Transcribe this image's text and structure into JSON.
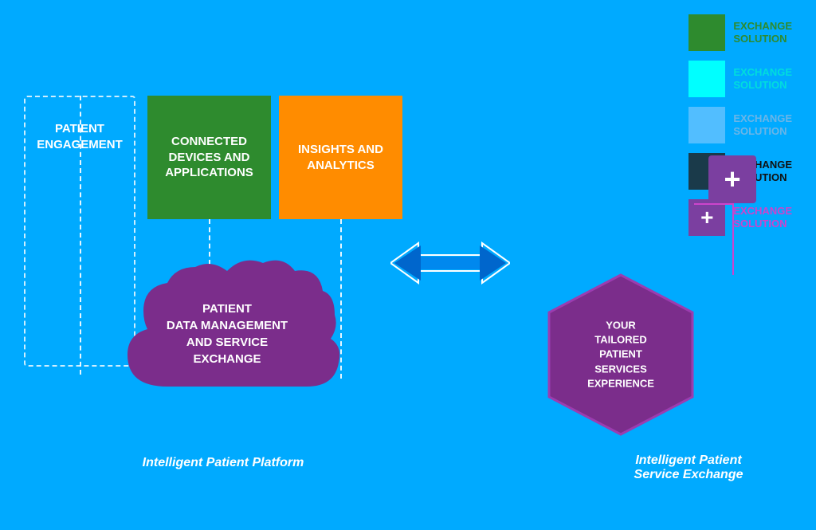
{
  "background_color": "#00AAFF",
  "legend": {
    "items": [
      {
        "id": "legend-green",
        "color": "#2E8B2E",
        "label": "EXCHANGE\nSOLUTION",
        "label_color": "#2E8B2E",
        "opacity": 1
      },
      {
        "id": "legend-cyan",
        "color": "#00FFFF",
        "label": "EXCHANGE\nSOLUTION",
        "label_color": "#00DDDD",
        "opacity": 1
      },
      {
        "id": "legend-light",
        "color": "#88CCFF",
        "label": "EXCHANGE\nSOLUTION",
        "label_color": "#88BBDD",
        "opacity": 0.6
      },
      {
        "id": "legend-dark",
        "color": "#1A3A4A",
        "label": "EXCHANGE\nSOLUTION",
        "label_color": "#222222",
        "opacity": 1
      },
      {
        "id": "legend-purple",
        "color": "#7B3FA0",
        "label": "EXCHANGE\nSOLUTION",
        "label_color": "#CC44CC",
        "opacity": 1
      }
    ]
  },
  "diagram": {
    "patient_engagement_label": "PATIENT\nENGAGEMENT",
    "connected_devices_label": "CONNECTED\nDEVICES AND\nAPPLICATIONS",
    "insights_analytics_label": "INSIGHTS AND\nANALYTICS",
    "cloud_label": "PATIENT\nDATA MANAGEMENT\nAND SERVICE\nEXCHANGE",
    "platform_label": "Intelligent Patient Platform",
    "hexagon_label": "YOUR\nTAILORED\nPATIENT\nSERVICES\nEXPERIENCE",
    "service_label": "Intelligent Patient\nService Exchange",
    "plus_symbol": "+"
  }
}
